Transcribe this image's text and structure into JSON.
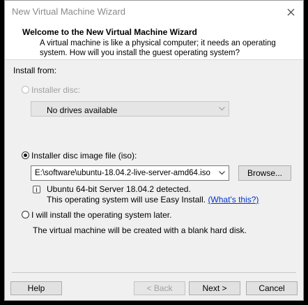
{
  "window": {
    "title": "New Virtual Machine Wizard"
  },
  "header": {
    "title": "Welcome to the New Virtual Machine Wizard",
    "description": "A virtual machine is like a physical computer; it needs an operating system. How will you install the guest operating system?"
  },
  "install_from": {
    "label": "Install from:",
    "installer_disc": {
      "label": "Installer disc:",
      "selected": false,
      "disabled": true,
      "dropdown_value": "No drives available"
    },
    "iso": {
      "label": "Installer disc image file (iso):",
      "selected": true,
      "path": "E:\\software\\ubuntu-18.04.2-live-server-amd64.iso",
      "browse_label": "Browse...",
      "detected_text": "Ubuntu 64-bit Server 18.04.2 detected.",
      "easy_install_text": "This operating system will use Easy Install.",
      "whats_this_link": "(What's this?)"
    },
    "later": {
      "label": "I will install the operating system later.",
      "selected": false,
      "description": "The virtual machine will be created with a blank hard disk."
    }
  },
  "footer": {
    "help": "Help",
    "back": "< Back",
    "next": "Next >",
    "cancel": "Cancel"
  },
  "colors": {
    "link": "#0033cc",
    "disabled_text": "#a0a0a0",
    "header_bg": "#ffffff",
    "body_bg": "#f0f0f0"
  },
  "icons": {
    "close": "close-icon",
    "info": "info-icon",
    "chevron": "chevron-down-icon"
  }
}
